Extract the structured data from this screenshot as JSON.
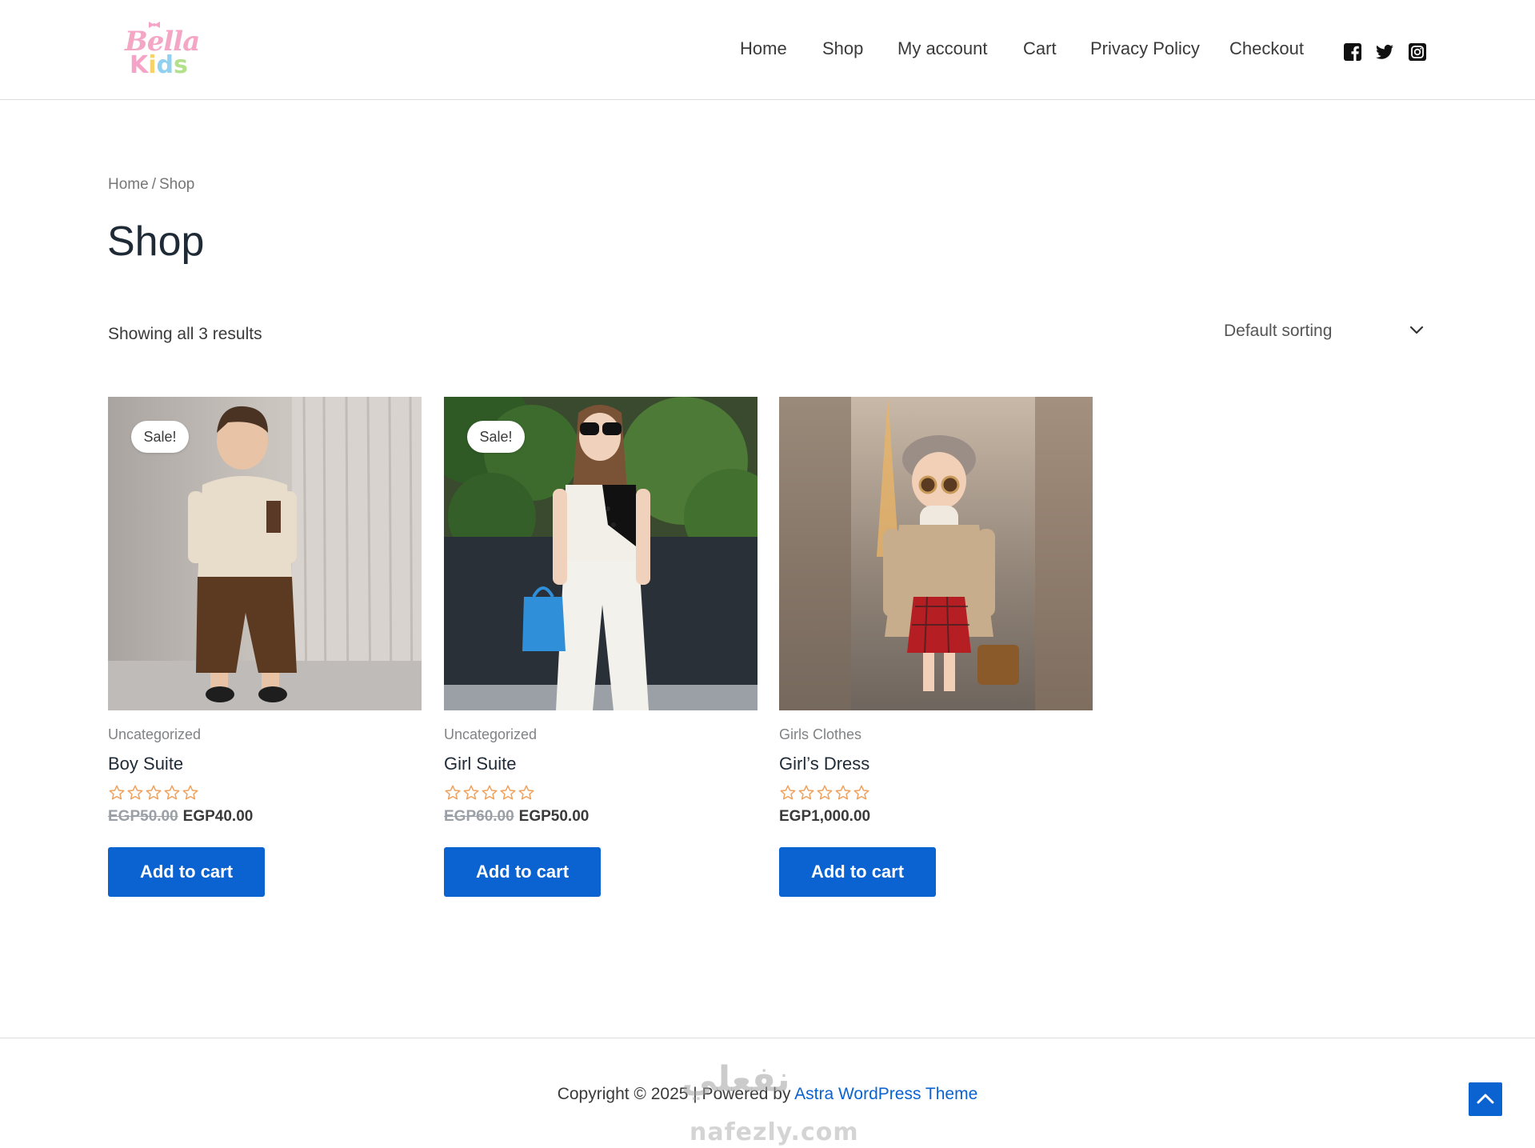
{
  "header": {
    "logo_text_1": "Bella",
    "logo_text_2": [
      "K",
      "i",
      "d",
      "s"
    ],
    "nav": [
      "Home",
      "Shop",
      "My account",
      "Cart",
      "Privacy Policy",
      "Checkout"
    ],
    "social_icons": [
      "facebook-icon",
      "twitter-icon",
      "instagram-icon"
    ]
  },
  "breadcrumb": {
    "home": "Home",
    "separator": "/",
    "current": "Shop"
  },
  "page_title": "Shop",
  "result_count": "Showing all 3 results",
  "sorting": {
    "selected": "Default sorting"
  },
  "products": [
    {
      "badge": "Sale!",
      "category": "Uncategorized",
      "title": "Boy Suite",
      "rating": 0,
      "old_price": "EGP50.00",
      "price": "EGP40.00",
      "button": "Add to cart"
    },
    {
      "badge": "Sale!",
      "category": "Uncategorized",
      "title": "Girl Suite",
      "rating": 0,
      "old_price": "EGP60.00",
      "price": "EGP50.00",
      "button": "Add to cart"
    },
    {
      "badge": "",
      "category": "Girls Clothes",
      "title": "Girl’s Dress",
      "rating": 0,
      "old_price": "",
      "price": "EGP1,000.00",
      "button": "Add to cart"
    }
  ],
  "footer": {
    "copyright_prefix": "Copyright © 2025 | Powered by ",
    "theme_link": "Astra WordPress Theme",
    "watermark_ar": "نفعلي",
    "watermark_en": "nafezly.com"
  },
  "colors": {
    "accent": "#0a63d1",
    "text": "#3a3a3a",
    "star": "#f0a05a"
  }
}
